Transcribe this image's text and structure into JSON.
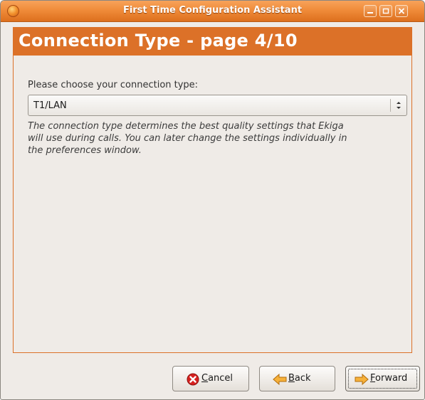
{
  "window": {
    "title": "First Time Configuration Assistant",
    "accent_color": "#dc7128"
  },
  "window_controls": {
    "minimize_icon": "minimize-icon",
    "maximize_icon": "maximize-icon",
    "close_icon": "close-icon"
  },
  "page": {
    "heading": "Connection Type - page 4/10",
    "prompt": "Please choose your connection type:",
    "connection_type": {
      "selected": "T1/LAN"
    },
    "description": "The connection type determines the best quality settings that Ekiga will use during calls. You can later change the settings individually in the preferences window."
  },
  "buttons": {
    "cancel": {
      "prefix": "",
      "mnemonic": "C",
      "rest": "ancel",
      "icon": "cancel-icon"
    },
    "back": {
      "prefix": "",
      "mnemonic": "B",
      "rest": "ack",
      "icon": "back-arrow-icon"
    },
    "forward": {
      "prefix": "",
      "mnemonic": "F",
      "rest": "orward",
      "icon": "forward-arrow-icon"
    }
  }
}
